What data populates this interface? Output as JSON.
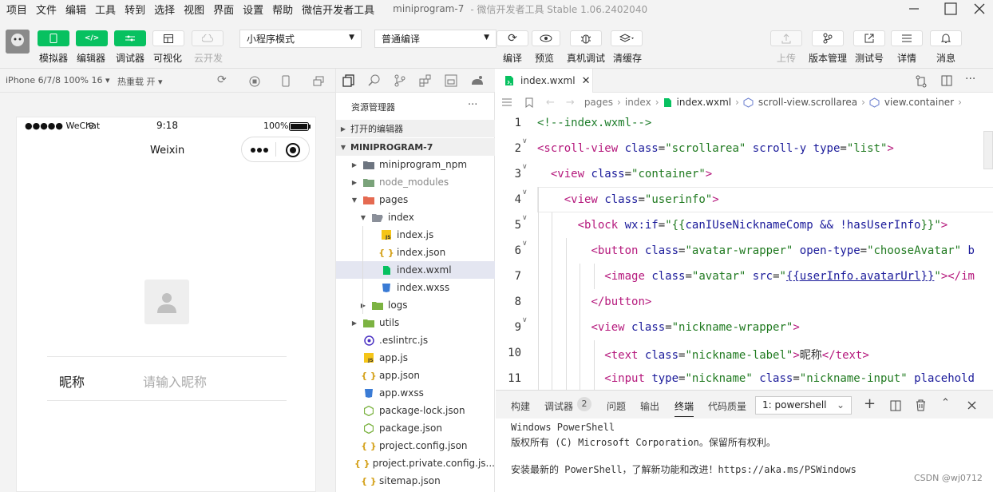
{
  "menubar": {
    "items": [
      "项目",
      "文件",
      "编辑",
      "工具",
      "转到",
      "选择",
      "视图",
      "界面",
      "设置",
      "帮助",
      "微信开发者工具"
    ],
    "project": "miniprogram-7",
    "title": "- 微信开发者工具 Stable 1.06.2402040"
  },
  "toolbar": {
    "left_buttons": [
      "模拟器",
      "编辑器",
      "调试器",
      "可视化",
      "云开发"
    ],
    "mode_select": "小程序模式",
    "compile_select": "普通编译",
    "mid_buttons": [
      "编译",
      "预览",
      "真机调试",
      "清缓存"
    ],
    "right_buttons": [
      "上传",
      "版本管理",
      "测试号",
      "详情",
      "消息"
    ]
  },
  "simulator": {
    "device": "iPhone 6/7/8 100% 16",
    "hot_reload": "热重载 开",
    "status_carrier": "●●●●● WeChat",
    "status_time": "9:18",
    "status_battery": "100%",
    "nav_title": "Weixin",
    "nickname_label": "昵称",
    "nickname_placeholder": "请输入昵称"
  },
  "explorer": {
    "title": "资源管理器",
    "open_editors": "打开的编辑器",
    "project": "MINIPROGRAM-7",
    "files": [
      "miniprogram_npm",
      "node_modules",
      "pages",
      "index",
      "index.js",
      "index.json",
      "index.wxml",
      "index.wxss",
      "logs",
      "utils",
      ".eslintrc.js",
      "app.js",
      "app.json",
      "app.wxss",
      "package-lock.json",
      "package.json",
      "project.config.json",
      "project.private.config.js...",
      "sitemap.json"
    ]
  },
  "editor": {
    "tab": "index.wxml",
    "breadcrumb": [
      "pages",
      "index",
      "index.wxml",
      "scroll-view.scrollarea",
      "view.container"
    ],
    "line_numbers": [
      "1",
      "2",
      "3",
      "4",
      "5",
      "6",
      "7",
      "8",
      "9",
      "10",
      "11"
    ]
  },
  "panel": {
    "tabs": [
      "构建",
      "调试器",
      "问题",
      "输出",
      "终端",
      "代码质量"
    ],
    "debug_count": "2",
    "terminal_select": "1: powershell",
    "terminal_lines": [
      "Windows PowerShell",
      "版权所有 (C)  Microsoft Corporation。保留所有权利。",
      "",
      "安装最新的 PowerShell，了解新功能和改进！https://aka.ms/PSWindows"
    ],
    "watermark": "CSDN @wj0712"
  },
  "colors": {
    "accent": "#07c160",
    "selection": "#e4e6f1",
    "tag": "#b5187c",
    "string": "#207a20"
  }
}
